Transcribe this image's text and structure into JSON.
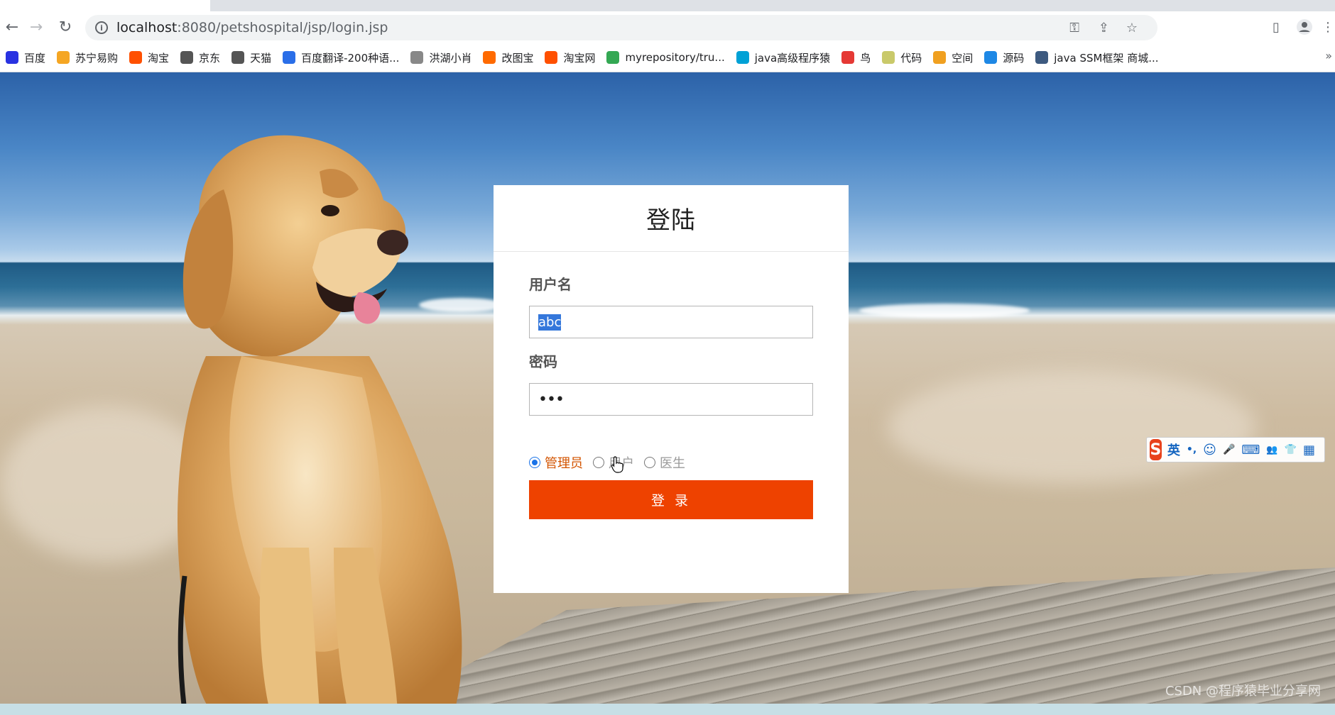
{
  "browser": {
    "url_host": "localhost",
    "url_path": ":8080/petshospital/jsp/login.jsp",
    "bookmarks": [
      {
        "label": "百度",
        "color": "#2932e1"
      },
      {
        "label": "苏宁易购",
        "color": "#f5a623"
      },
      {
        "label": "淘宝",
        "color": "#ff5000"
      },
      {
        "label": "京东",
        "color": "#555555"
      },
      {
        "label": "天猫",
        "color": "#555555"
      },
      {
        "label": "百度翻译-200种语...",
        "color": "#2a6ee8"
      },
      {
        "label": "洪湖小肖",
        "color": "#888888"
      },
      {
        "label": "改图宝",
        "color": "#ff6a00"
      },
      {
        "label": "淘宝网",
        "color": "#ff5000"
      },
      {
        "label": "myrepository/tru...",
        "color": "#34a853"
      },
      {
        "label": "java高级程序猿",
        "color": "#00a1d6"
      },
      {
        "label": "鸟",
        "color": "#e53935"
      },
      {
        "label": "代码",
        "color": "#c9c96a"
      },
      {
        "label": "空间",
        "color": "#f0a020"
      },
      {
        "label": "源码",
        "color": "#1e88e5"
      },
      {
        "label": "java SSM框架 商城...",
        "color": "#3d5a80"
      }
    ],
    "more_label": "»"
  },
  "login": {
    "title": "登陆",
    "username_label": "用户名",
    "username_value": "abc",
    "password_label": "密码",
    "password_value": "•••",
    "roles": [
      {
        "label": "管理员",
        "checked": true
      },
      {
        "label": "用户",
        "checked": false
      },
      {
        "label": "医生",
        "checked": false
      }
    ],
    "submit_label": "登 录"
  },
  "ime": {
    "logo": "S",
    "mode": "英",
    "items": [
      "•,",
      "☺",
      "🎤",
      "⌨",
      "👥",
      "👕",
      "▦"
    ]
  },
  "watermark": "CSDN @程序猿毕业分享网"
}
